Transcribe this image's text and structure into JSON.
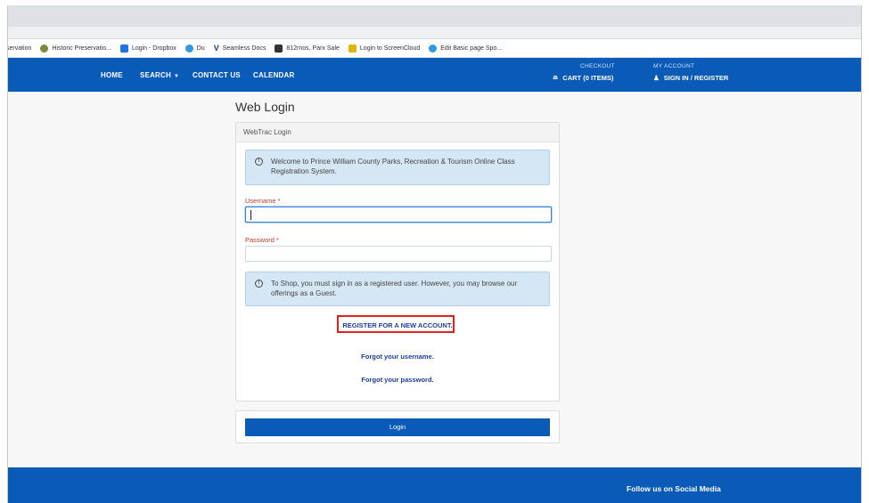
{
  "bookmarks": [
    {
      "label": "servation",
      "color": ""
    },
    {
      "label": "Historic Preservatio...",
      "color": "#7d8a3a"
    },
    {
      "label": "Login - Dropbox",
      "color": "#1e73e8"
    },
    {
      "label": "Du",
      "color": "#2f9ae0"
    },
    {
      "label": "Seamless Docs",
      "color": "#1d3f8f"
    },
    {
      "label": "812rnos. Parx Sale",
      "color": "#333333"
    },
    {
      "label": "Login to ScreenCloud",
      "color": "#e0b400"
    },
    {
      "label": "Edit Basic page Spo...",
      "color": "#2f9ae0"
    }
  ],
  "nav": {
    "home": "HOME",
    "search": "SEARCH",
    "search_caret": "▼",
    "contact": "CONTACT US",
    "calendar": "CALENDAR",
    "checkout_label": "CHECKOUT",
    "cart": "CART (0 ITEMS)",
    "cart_icon": "≘",
    "account_label": "MY ACCOUNT",
    "signin": "SIGN IN / REGISTER",
    "user_icon": "♟"
  },
  "page": {
    "title": "Web Login",
    "card_header": "WebTrac Login",
    "welcome": "Welcome to Prince William County Parks, Recreation & Tourism Online Class Registration System.",
    "info_icon": "!",
    "username_label": "Username *",
    "username_value": "",
    "password_label": "Password *",
    "password_value": "",
    "shop_notice": "To Shop, you must sign in as a registered user. However, you may browse our offerings as a Guest.",
    "register_link": "REGISTER FOR A NEW ACCOUNT.",
    "forgot_username": "Forgot your username.",
    "forgot_password": "Forgot your password.",
    "login_button": "Login"
  },
  "footer": {
    "social_title": "Follow us on Social Media"
  },
  "colors": {
    "brand_blue": "#0a5ab8",
    "highlight_red": "#e02222",
    "required_red": "#c0392b",
    "link_blue": "#1e3f99"
  }
}
